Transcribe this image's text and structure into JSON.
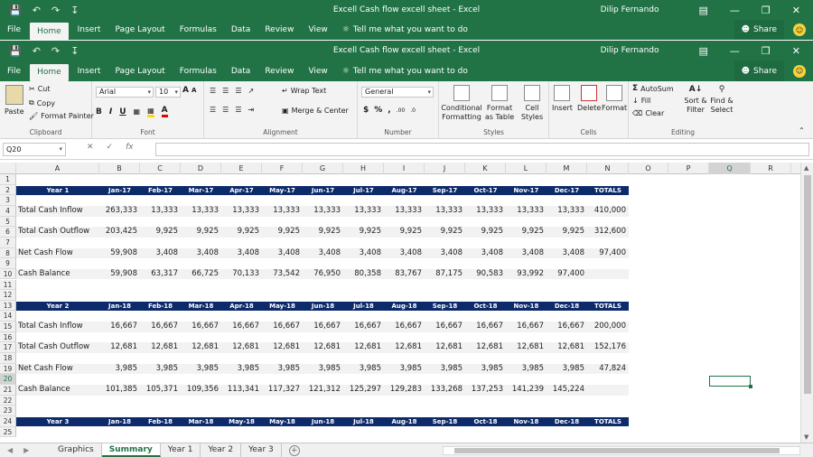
{
  "window": {
    "title": "Excell Cash flow excell sheet  -  Excel",
    "user": "Dilip Fernando"
  },
  "ribbon_tabs": [
    "File",
    "Home",
    "Insert",
    "Page Layout",
    "Formulas",
    "Data",
    "Review",
    "View"
  ],
  "active_tab": "Home",
  "tell_me": "Tell me what you want to do",
  "share": "Share",
  "ribbon": {
    "clipboard": {
      "paste": "Paste",
      "cut": "Cut",
      "copy": "Copy",
      "format_painter": "Format Painter",
      "label": "Clipboard"
    },
    "font": {
      "name": "Arial",
      "size": "10",
      "label": "Font"
    },
    "alignment": {
      "wrap": "Wrap Text",
      "merge": "Merge & Center",
      "label": "Alignment"
    },
    "number": {
      "format": "General",
      "label": "Number"
    },
    "styles": {
      "conditional": "Conditional Formatting",
      "format_table": "Format as Table",
      "cell_styles": "Cell Styles",
      "label": "Styles"
    },
    "cells": {
      "insert": "Insert",
      "delete": "Delete",
      "format": "Format",
      "label": "Cells"
    },
    "editing": {
      "autosum": "AutoSum",
      "fill": "Fill",
      "clear": "Clear",
      "sort": "Sort & Filter",
      "find": "Find & Select",
      "label": "Editing"
    }
  },
  "formula_bar": {
    "name_box": "Q20",
    "formula": ""
  },
  "columns": [
    "A",
    "B",
    "C",
    "D",
    "E",
    "F",
    "G",
    "H",
    "I",
    "J",
    "K",
    "L",
    "M",
    "N",
    "O",
    "P",
    "Q",
    "R"
  ],
  "selected_column": "Q",
  "selected_row": 20,
  "row_numbers": [
    1,
    2,
    3,
    4,
    5,
    6,
    7,
    8,
    9,
    10,
    11,
    12,
    13,
    14,
    15,
    16,
    17,
    18,
    19,
    20,
    21,
    22,
    23,
    24,
    25
  ],
  "sheet": {
    "year1": {
      "title": "Year 1",
      "months": [
        "Jan-17",
        "Feb-17",
        "Mar-17",
        "Apr-17",
        "May-17",
        "Jun-17",
        "Jul-17",
        "Aug-17",
        "Sep-17",
        "Oct-17",
        "Nov-17",
        "Dec-17"
      ],
      "totals_label": "TOTALS",
      "rows": [
        {
          "label": "Total Cash Inflow",
          "values": [
            "263,333",
            "13,333",
            "13,333",
            "13,333",
            "13,333",
            "13,333",
            "13,333",
            "13,333",
            "13,333",
            "13,333",
            "13,333",
            "13,333"
          ],
          "total": "410,000"
        },
        {
          "label": "Total Cash Outflow",
          "values": [
            "203,425",
            "9,925",
            "9,925",
            "9,925",
            "9,925",
            "9,925",
            "9,925",
            "9,925",
            "9,925",
            "9,925",
            "9,925",
            "9,925"
          ],
          "total": "312,600"
        },
        {
          "label": "Net Cash Flow",
          "values": [
            "59,908",
            "3,408",
            "3,408",
            "3,408",
            "3,408",
            "3,408",
            "3,408",
            "3,408",
            "3,408",
            "3,408",
            "3,408",
            "3,408"
          ],
          "total": "97,400"
        },
        {
          "label": "Cash Balance",
          "values": [
            "59,908",
            "63,317",
            "66,725",
            "70,133",
            "73,542",
            "76,950",
            "80,358",
            "83,767",
            "87,175",
            "90,583",
            "93,992",
            "97,400"
          ],
          "total": ""
        }
      ]
    },
    "year2": {
      "title": "Year 2",
      "months": [
        "Jan-18",
        "Feb-18",
        "Mar-18",
        "Apr-18",
        "May-18",
        "Jun-18",
        "Jul-18",
        "Aug-18",
        "Sep-18",
        "Oct-18",
        "Nov-18",
        "Dec-18"
      ],
      "totals_label": "TOTALS",
      "rows": [
        {
          "label": "Total Cash Inflow",
          "values": [
            "16,667",
            "16,667",
            "16,667",
            "16,667",
            "16,667",
            "16,667",
            "16,667",
            "16,667",
            "16,667",
            "16,667",
            "16,667",
            "16,667"
          ],
          "total": "200,000"
        },
        {
          "label": "Total Cash Outflow",
          "values": [
            "12,681",
            "12,681",
            "12,681",
            "12,681",
            "12,681",
            "12,681",
            "12,681",
            "12,681",
            "12,681",
            "12,681",
            "12,681",
            "12,681"
          ],
          "total": "152,176"
        },
        {
          "label": "Net Cash Flow",
          "values": [
            "3,985",
            "3,985",
            "3,985",
            "3,985",
            "3,985",
            "3,985",
            "3,985",
            "3,985",
            "3,985",
            "3,985",
            "3,985",
            "3,985"
          ],
          "total": "47,824"
        },
        {
          "label": "Cash Balance",
          "values": [
            "101,385",
            "105,371",
            "109,356",
            "113,341",
            "117,327",
            "121,312",
            "125,297",
            "129,283",
            "133,268",
            "137,253",
            "141,239",
            "145,224"
          ],
          "total": ""
        }
      ]
    },
    "year3": {
      "title": "Year 3",
      "months": [
        "Jan-18",
        "Feb-18",
        "Mar-18",
        "May-18",
        "May-18",
        "Jun-18",
        "Jul-18",
        "Aug-18",
        "Sep-18",
        "Oct-18",
        "Nov-18",
        "Dec-18"
      ],
      "totals_label": "TOTALS"
    }
  },
  "sheet_tabs": [
    "Graphics",
    "Summary",
    "Year 1",
    "Year 2",
    "Year 3"
  ],
  "active_sheet": "Summary",
  "colors": {
    "excel_green": "#217346",
    "header_navy": "#0d2b6b"
  }
}
